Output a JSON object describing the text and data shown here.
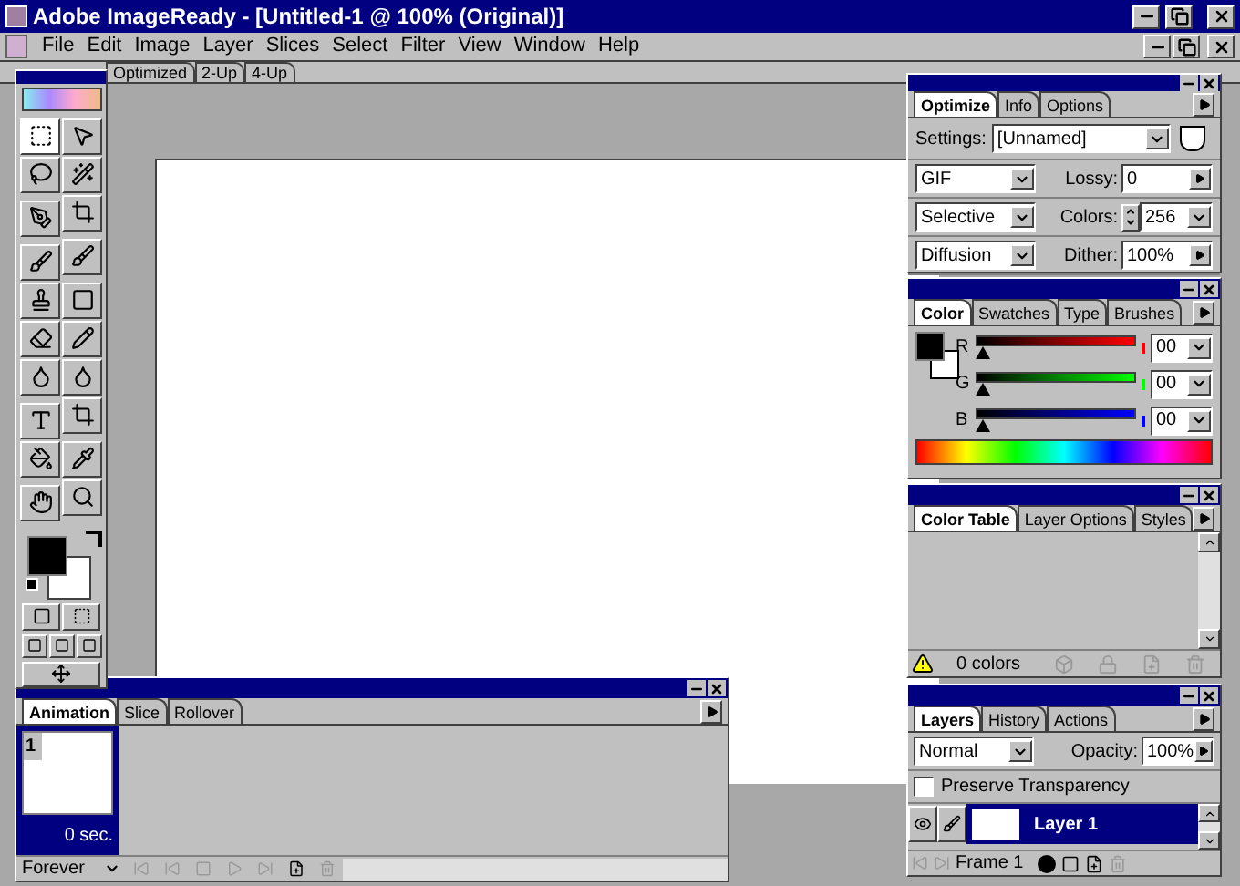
{
  "window": {
    "title": "Adobe ImageReady - [Untitled-1 @ 100% (Original)]"
  },
  "menu": [
    "File",
    "Edit",
    "Image",
    "Layer",
    "Slices",
    "Select",
    "Filter",
    "View",
    "Window",
    "Help"
  ],
  "document": {
    "tabs": [
      "Optimized",
      "2-Up",
      "4-Up"
    ]
  },
  "optimize": {
    "tabs": [
      {
        "label": "Optimize",
        "selected": true
      },
      {
        "label": "Info",
        "selected": false
      },
      {
        "label": "Options",
        "selected": false
      }
    ],
    "settings_label": "Settings:",
    "settings_value": "[Unnamed]",
    "rows": [
      {
        "select": "GIF",
        "label": "Lossy:",
        "value": "0",
        "kind": "arrow"
      },
      {
        "select": "Selective",
        "label": "Colors:",
        "value": "256",
        "kind": "spin"
      },
      {
        "select": "Diffusion",
        "label": "Dither:",
        "value": "100%",
        "kind": "arrow"
      }
    ]
  },
  "color": {
    "tabs": [
      {
        "label": "Color",
        "selected": true
      },
      {
        "label": "Swatches",
        "selected": false
      },
      {
        "label": "Type",
        "selected": false
      },
      {
        "label": "Brushes",
        "selected": false
      }
    ],
    "channels": [
      {
        "name": "R",
        "value": "00",
        "level": 0,
        "color": "#ff0000"
      },
      {
        "name": "G",
        "value": "00",
        "level": 0,
        "color": "#00ff00"
      },
      {
        "name": "B",
        "value": "00",
        "level": 0,
        "color": "#0000ff"
      }
    ]
  },
  "color_table": {
    "tabs": [
      {
        "label": "Color Table",
        "selected": true
      },
      {
        "label": "Layer Options",
        "selected": false
      },
      {
        "label": "Styles",
        "selected": false
      }
    ],
    "count": "0 colors"
  },
  "layers": {
    "tabs": [
      {
        "label": "Layers",
        "selected": true
      },
      {
        "label": "History",
        "selected": false
      },
      {
        "label": "Actions",
        "selected": false
      }
    ],
    "blend": "Normal",
    "opacity_label": "Opacity:",
    "opacity": "100%",
    "preserve_label": "Preserve Transparency",
    "preserve_checked": false,
    "items": [
      {
        "name": "Layer 1",
        "selected": true
      }
    ],
    "frame": "Frame 1"
  },
  "animation": {
    "tabs": [
      {
        "label": "Animation",
        "selected": true
      },
      {
        "label": "Slice",
        "selected": false
      },
      {
        "label": "Rollover",
        "selected": false
      }
    ],
    "frames": [
      {
        "number": "1",
        "delay": "0 sec.",
        "selected": true
      }
    ],
    "loop": "Forever"
  }
}
